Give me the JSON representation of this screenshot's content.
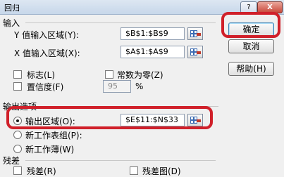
{
  "window": {
    "title": "回归",
    "help_button": "?",
    "close_button": "X"
  },
  "buttons": {
    "ok": "确定",
    "cancel": "取消",
    "help": "帮助(H)"
  },
  "input": {
    "section_label": "输入",
    "y_range_label": "Y 值输入区域(Y):",
    "y_range_value": "$B$1:$B$9",
    "x_range_label": "X 值输入区域(X):",
    "x_range_value": "$A$1:$A$9",
    "labels_label": "标志(L)",
    "labels_checked": false,
    "constant_zero_label": "常数为零(Z)",
    "constant_zero_checked": false,
    "confidence_label": "置信度(F)",
    "confidence_checked": false,
    "confidence_value": "95",
    "percent_sign": "%"
  },
  "output": {
    "section_label": "输出选项",
    "output_range_label": "输出区域(O):",
    "output_range_value": "$E$11:$N$33",
    "output_range_selected": true,
    "new_sheet_label": "新工作表组(P):",
    "new_workbook_label": "新工作薄(W)"
  },
  "residuals": {
    "section_label": "残差",
    "residuals_label": "残差(R)",
    "residual_plot_label": "残差图(D)"
  },
  "colors": {
    "highlight": "#d0202a",
    "default_button_border": "#3c7fb1"
  }
}
